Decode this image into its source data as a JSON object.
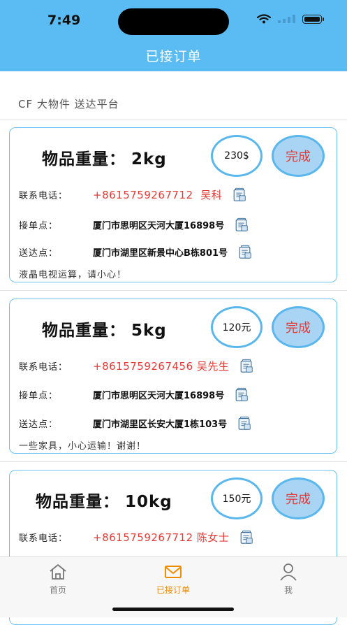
{
  "status_bar": {
    "time": "7:49"
  },
  "nav": {
    "title": "已接订单"
  },
  "platform_title": "CF 大物件 送达平台",
  "labels": {
    "weight": "物品重量：",
    "phone": "联系电话：",
    "pickup": "接单点：",
    "delivery": "送达点：",
    "done": "完成"
  },
  "orders": [
    {
      "weight": "2kg",
      "price": "230$",
      "phone": "+8615759267712",
      "contact": "吴科",
      "pickup": "厦门市思明区天河大厦16898号",
      "delivery": "厦门市湖里区新景中心B栋801号",
      "note": "液晶电视运算，请小心！"
    },
    {
      "weight": "5kg",
      "price": "120元",
      "phone": "+8615759267456",
      "contact": "吴先生",
      "pickup": "厦门市思明区天河大厦16898号",
      "delivery": "厦门市湖里区长安大厦1栋103号",
      "note": "一些家具，小心运输！谢谢！"
    },
    {
      "weight": "10kg",
      "price": "150元",
      "phone": "+8615759267712",
      "contact": "陈女士"
    }
  ],
  "tabbar": {
    "items": [
      {
        "label": "首页",
        "icon": "home-icon"
      },
      {
        "label": "已接订单",
        "icon": "mail-icon",
        "active": true
      },
      {
        "label": "我",
        "icon": "person-icon"
      }
    ]
  },
  "colors": {
    "header": "#5bbcf3",
    "accent_red": "#e53935",
    "card_border": "#6ec3f2",
    "tab_active": "#ef8c00"
  }
}
